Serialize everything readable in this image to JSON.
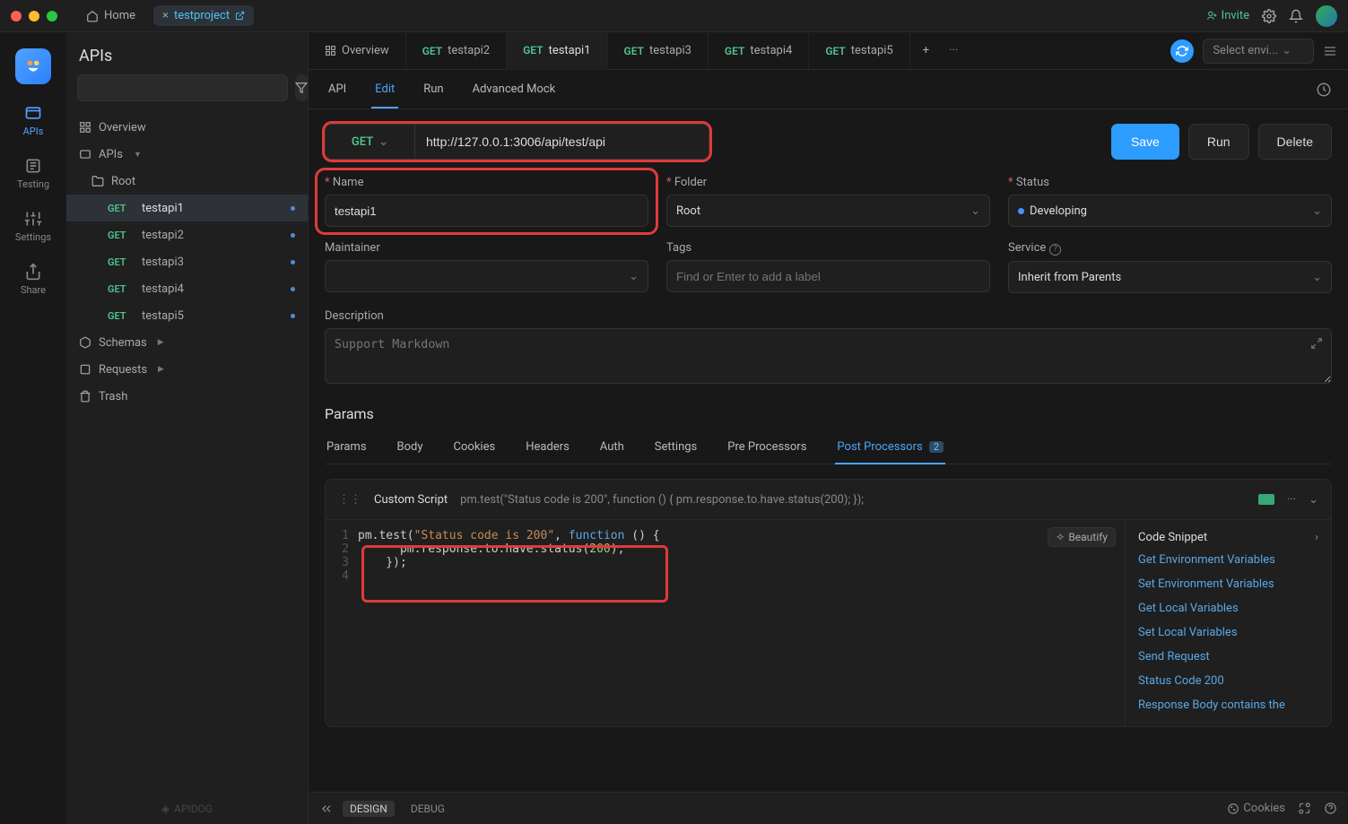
{
  "titlebar": {
    "home": "Home",
    "project": "testproject",
    "invite": "Invite"
  },
  "rail": {
    "items": [
      {
        "label": "APIs",
        "active": true
      },
      {
        "label": "Testing",
        "active": false
      },
      {
        "label": "Settings",
        "active": false
      },
      {
        "label": "Share",
        "active": false
      }
    ]
  },
  "sidebar": {
    "title": "APIs",
    "search_placeholder": "",
    "overview": "Overview",
    "apis_label": "APIs",
    "root_label": "Root",
    "endpoints": [
      {
        "method": "GET",
        "name": "testapi1",
        "active": true
      },
      {
        "method": "GET",
        "name": "testapi2",
        "active": false
      },
      {
        "method": "GET",
        "name": "testapi3",
        "active": false
      },
      {
        "method": "GET",
        "name": "testapi4",
        "active": false
      },
      {
        "method": "GET",
        "name": "testapi5",
        "active": false
      }
    ],
    "schemas": "Schemas",
    "requests": "Requests",
    "trash": "Trash",
    "footer": "APIDOG"
  },
  "editorTabs": {
    "items": [
      {
        "icon": "overview",
        "label": "Overview",
        "active": false
      },
      {
        "method": "GET",
        "label": "testapi2",
        "active": false
      },
      {
        "method": "GET",
        "label": "testapi1",
        "active": true
      },
      {
        "method": "GET",
        "label": "testapi3",
        "active": false
      },
      {
        "method": "GET",
        "label": "testapi4",
        "active": false
      },
      {
        "method": "GET",
        "label": "testapi5",
        "active": false
      }
    ],
    "env_placeholder": "Select envi..."
  },
  "subtabs": {
    "items": [
      "API",
      "Edit",
      "Run",
      "Advanced Mock"
    ],
    "active": "Edit"
  },
  "request": {
    "method": "GET",
    "url": "http://127.0.0.1:3006/api/test/api",
    "save": "Save",
    "run": "Run",
    "delete": "Delete"
  },
  "form": {
    "name_label": "Name",
    "name_value": "testapi1",
    "folder_label": "Folder",
    "folder_value": "Root",
    "status_label": "Status",
    "status_value": "Developing",
    "maintainer_label": "Maintainer",
    "maintainer_value": "",
    "tags_label": "Tags",
    "tags_placeholder": "Find or Enter to add a label",
    "service_label": "Service",
    "service_value": "Inherit from Parents",
    "description_label": "Description",
    "description_placeholder": "Support Markdown"
  },
  "params": {
    "title": "Params",
    "tabs": [
      {
        "label": "Params"
      },
      {
        "label": "Body"
      },
      {
        "label": "Cookies"
      },
      {
        "label": "Headers"
      },
      {
        "label": "Auth"
      },
      {
        "label": "Settings"
      },
      {
        "label": "Pre Processors"
      },
      {
        "label": "Post Processors",
        "badge": "2",
        "active": true
      }
    ]
  },
  "script": {
    "title": "Custom Script",
    "preview": "pm.test(\"Status code is 200\", function () { pm.response.to.have.status(200); });",
    "beautify": "Beautify",
    "code_lines": [
      {
        "n": "1",
        "raw": "pm.test(\"Status code is 200\", function () {"
      },
      {
        "n": "2",
        "raw": "    pm.response.to.have.status(200);"
      },
      {
        "n": "3",
        "raw": "  });"
      },
      {
        "n": "4",
        "raw": ""
      }
    ],
    "snippet_title": "Code Snippet",
    "snippets": [
      "Get Environment Variables",
      "Set Environment Variables",
      "Get Local Variables",
      "Set Local Variables",
      "Send Request",
      "Status Code 200",
      "Response Body contains the"
    ]
  },
  "bottombar": {
    "design": "DESIGN",
    "debug": "DEBUG",
    "cookies": "Cookies"
  }
}
